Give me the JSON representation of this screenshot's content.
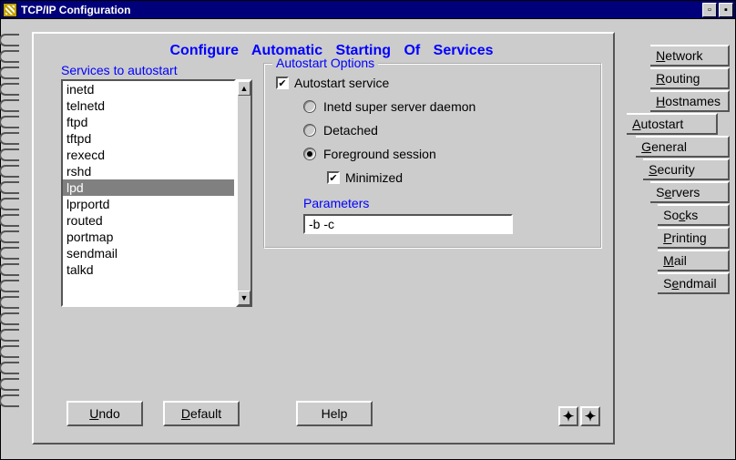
{
  "titlebar": {
    "title": "TCP/IP Configuration"
  },
  "header": "Configure  Automatic  Starting  Of  Services",
  "services_label": "Services to autostart",
  "services": [
    {
      "name": "inetd",
      "selected": false
    },
    {
      "name": "telnetd",
      "selected": false
    },
    {
      "name": "ftpd",
      "selected": false
    },
    {
      "name": "tftpd",
      "selected": false
    },
    {
      "name": "rexecd",
      "selected": false
    },
    {
      "name": "rshd",
      "selected": false
    },
    {
      "name": "lpd",
      "selected": true
    },
    {
      "name": "lprportd",
      "selected": false
    },
    {
      "name": "routed",
      "selected": false
    },
    {
      "name": "portmap",
      "selected": false
    },
    {
      "name": "sendmail",
      "selected": false
    },
    {
      "name": "talkd",
      "selected": false
    }
  ],
  "options": {
    "group_title": "Autostart Options",
    "autostart_label": "Autostart service",
    "autostart_checked": true,
    "mode": {
      "inetd": "Inetd super server daemon",
      "detached": "Detached",
      "foreground": "Foreground session",
      "selected": "foreground"
    },
    "minimized_label": "Minimized",
    "minimized_checked": true,
    "parameters_label": "Parameters",
    "parameters_value": "-b -c"
  },
  "buttons": {
    "undo": "Undo",
    "default": "Default",
    "help": "Help"
  },
  "tabs": {
    "group1": [
      "Network",
      "Routing",
      "Hostnames"
    ],
    "active": "Autostart",
    "group2": [
      "General",
      "Security",
      "Servers",
      "Socks",
      "Printing",
      "Mail",
      "Sendmail"
    ]
  }
}
